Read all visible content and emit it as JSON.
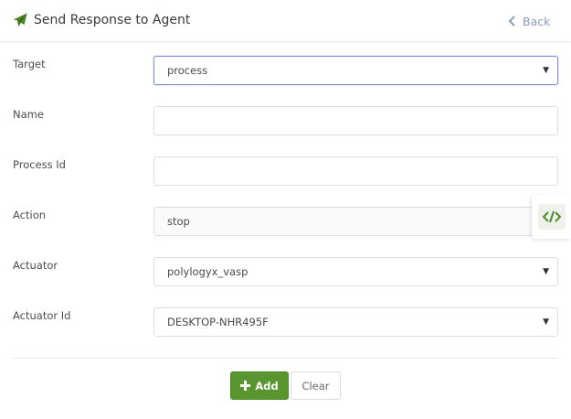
{
  "header": {
    "title": "Send Response to Agent",
    "back_label": "Back",
    "icon": "paper-plane-icon",
    "accent_color": "#5a962f"
  },
  "form": {
    "target": {
      "label": "Target",
      "value": "process"
    },
    "name": {
      "label": "Name",
      "value": ""
    },
    "process_id": {
      "label": "Process Id",
      "value": ""
    },
    "action": {
      "label": "Action",
      "value": "stop"
    },
    "actuator": {
      "label": "Actuator",
      "value": "polylogyx_vasp"
    },
    "actuator_id": {
      "label": "Actuator Id",
      "value": "DESKTOP-NHR495F"
    }
  },
  "buttons": {
    "add_label": "Add",
    "clear_label": "Clear"
  },
  "side_tab": {
    "icon": "code-icon"
  }
}
